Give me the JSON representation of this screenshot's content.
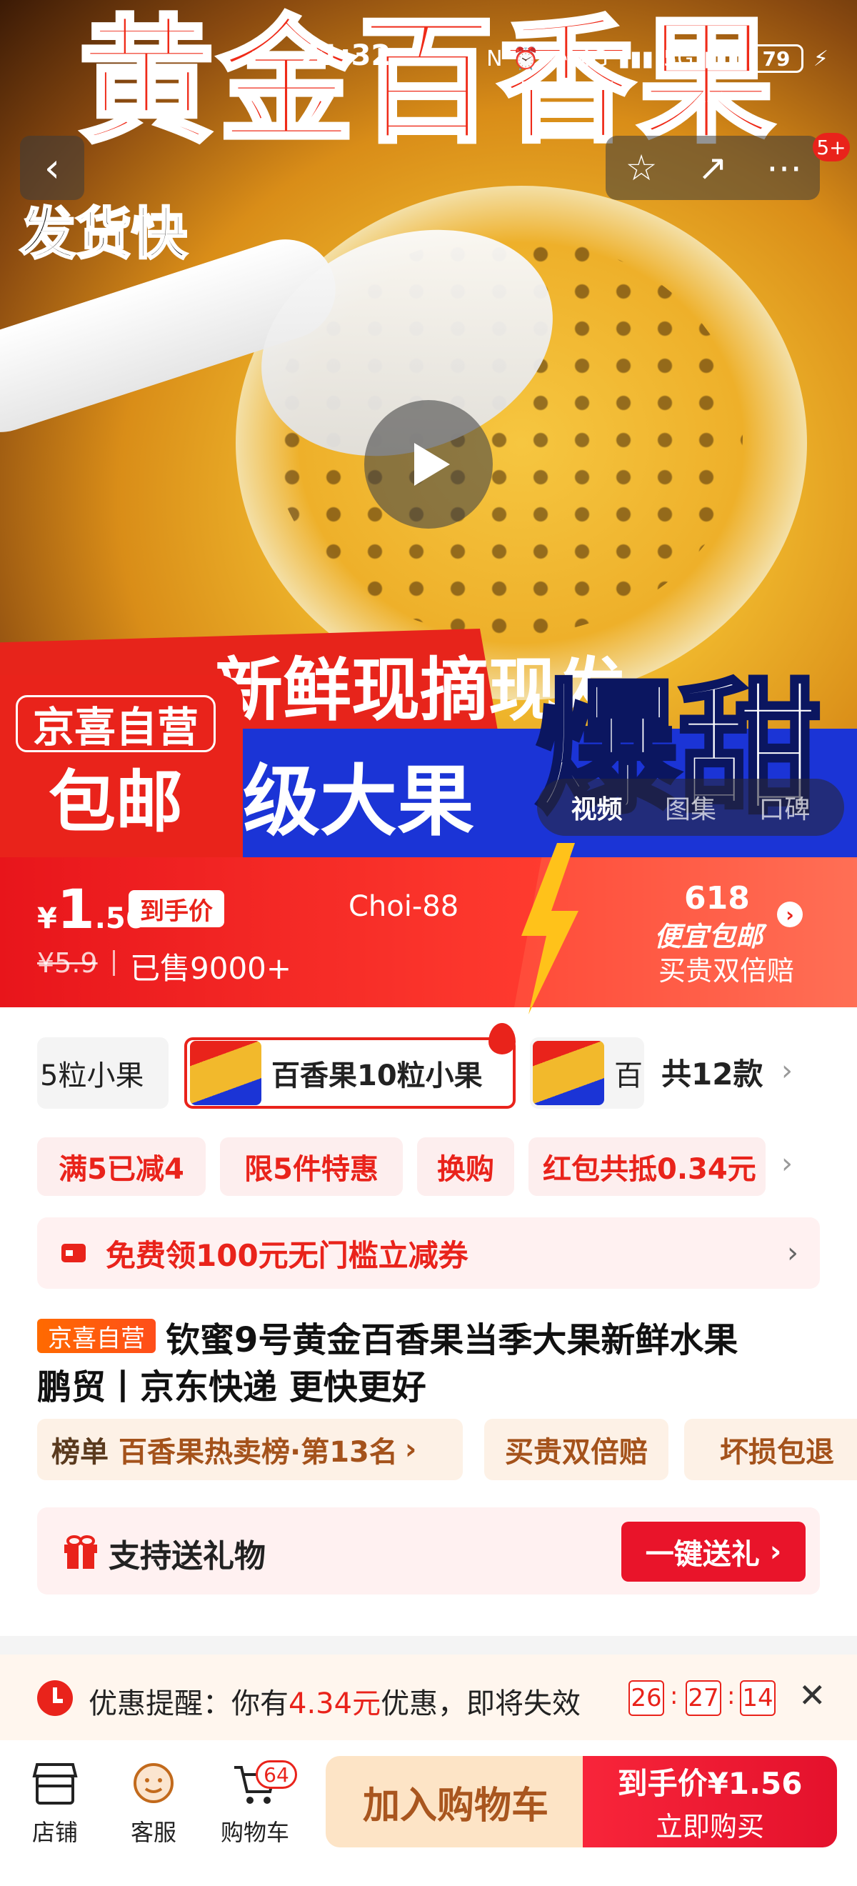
{
  "status_bar": {
    "time": "21:32",
    "battery": "79",
    "network": [
      "N",
      "4G",
      "5G"
    ]
  },
  "hero": {
    "title": "黄金百香果",
    "subtitle": "发货快",
    "banner_red": "新鲜现摘现发",
    "banner_blue": "级大果",
    "big_tag": "爆甜",
    "badge_line1": "京喜自营",
    "badge_line2": "包邮",
    "notification_count": "5+",
    "media_tabs": [
      "视频",
      "图集",
      "口碑"
    ],
    "icons": [
      "back-icon",
      "star-icon",
      "share-icon",
      "more-icon",
      "play-icon"
    ]
  },
  "price_bar": {
    "currency": "¥",
    "price_int": "1",
    "price_dec": ".56",
    "price_tag": "到手价",
    "coupon_code": "Choi-88",
    "original_price": "¥5.9",
    "sold": "已售9000+",
    "promo_618": "618",
    "promo_line": "便宜包邮",
    "guarantee": "买贵双倍赔"
  },
  "variants": {
    "items": [
      "5粒小果",
      "百香果10粒小果",
      "百"
    ],
    "total": "共12款"
  },
  "promos": [
    "满5已减4",
    "限5件特惠",
    "换购",
    "红包共抵0.34元"
  ],
  "coupon": {
    "text": "免费领100元无门槛立减券"
  },
  "product": {
    "badge": "京喜自营",
    "title_line1": "钦蜜9号黄金百香果当季大果新鲜水果",
    "title_line2": "鹏贸丨京东快递 更快更好"
  },
  "tags": {
    "rank_label": "榜单",
    "rank_text": "百香果热卖榜·第13名",
    "guarantee": "买贵双倍赔",
    "refund": "坏损包退"
  },
  "gift": {
    "text": "支持送礼物",
    "button": "一键送礼"
  },
  "reminder": {
    "prefix": "优惠提醒：你有",
    "amount": "4.34元",
    "suffix": "优惠，即将失效",
    "hours": "26",
    "minutes": "27",
    "seconds": "14"
  },
  "bottom": {
    "shop": "店铺",
    "service": "客服",
    "cart": "购物车",
    "cart_count": "64",
    "add_to_cart": "加入购物车",
    "buy_line1": "到手价¥1.56",
    "buy_line2": "立即购买"
  },
  "colors": {
    "brand_red": "#e9231b",
    "accent_blue": "#1b34d6",
    "cart_beige": "#fde4c6"
  }
}
